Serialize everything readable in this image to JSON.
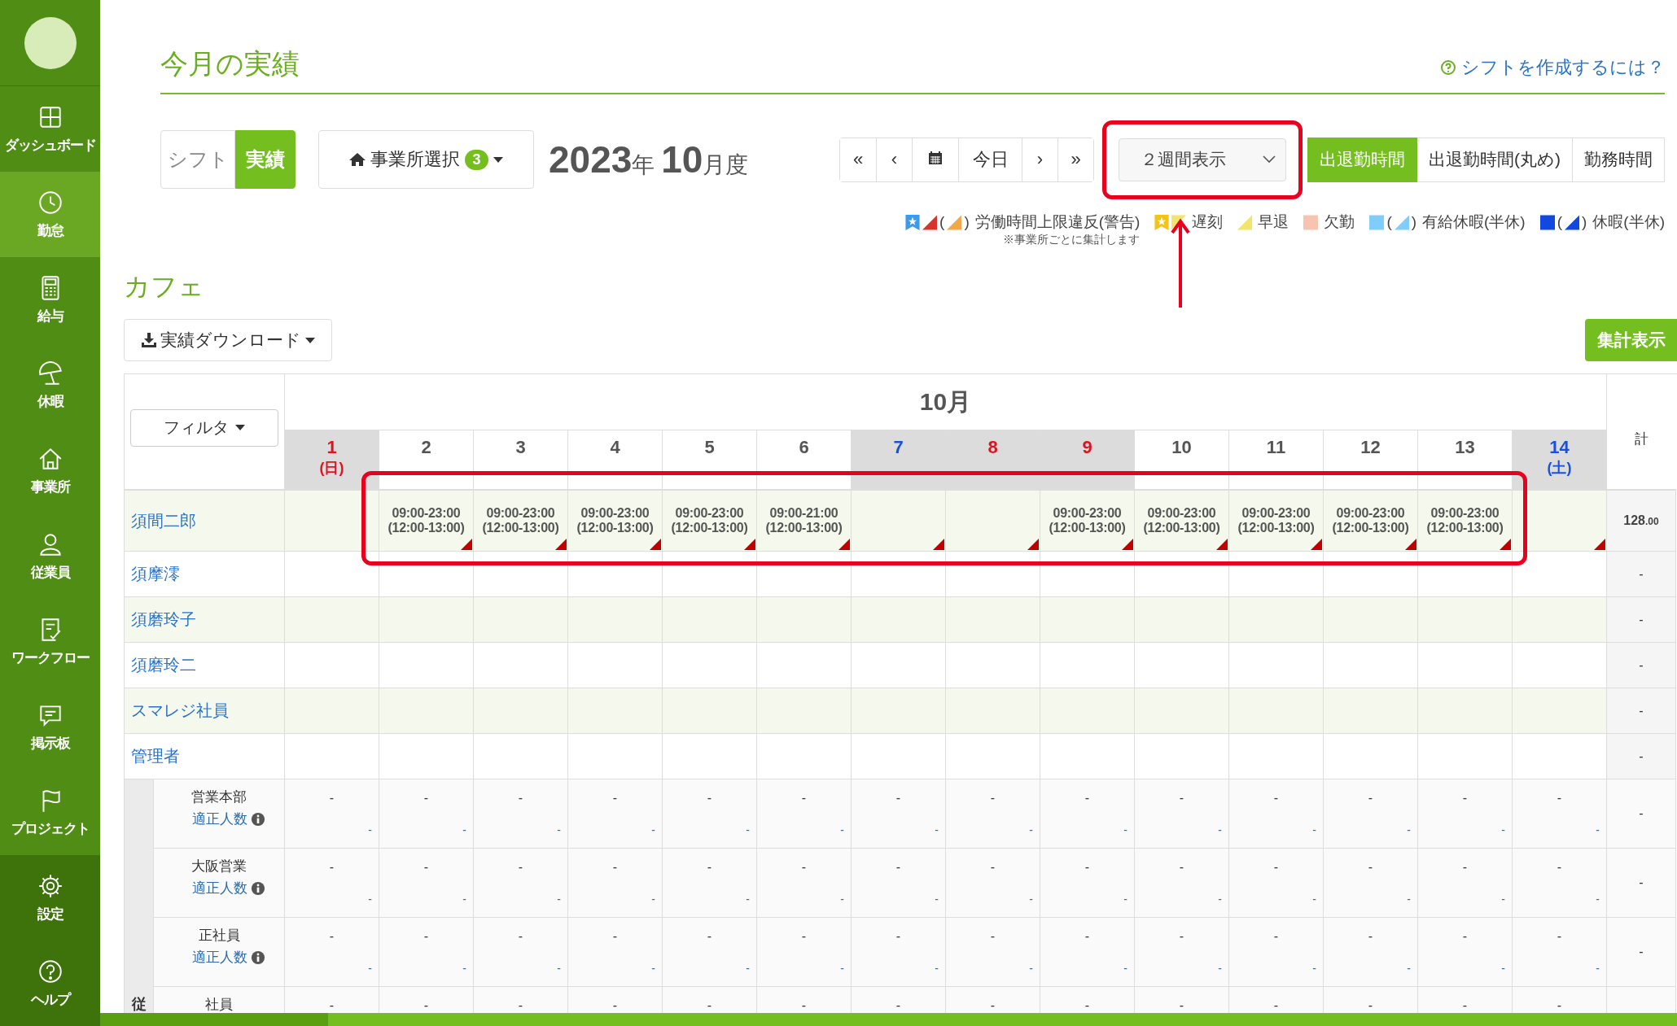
{
  "sidebar": {
    "items": [
      {
        "label": "ダッシュボード",
        "selected": false
      },
      {
        "label": "勤怠",
        "selected": true
      },
      {
        "label": "給与",
        "selected": false
      },
      {
        "label": "休暇",
        "selected": false
      },
      {
        "label": "事業所",
        "selected": false
      },
      {
        "label": "従業員",
        "selected": false
      },
      {
        "label": "ワークフロー",
        "selected": false
      },
      {
        "label": "掲示板",
        "selected": false
      },
      {
        "label": "プロジェクト",
        "selected": false
      }
    ],
    "footer_items": [
      {
        "label": "設定",
        "selected": false
      },
      {
        "label": "ヘルプ",
        "selected": false
      }
    ]
  },
  "page": {
    "title": "今月の実績",
    "help_link": "シフトを作成するには？"
  },
  "mode_toggle": [
    {
      "label": "シフト",
      "selected": false
    },
    {
      "label": "実績",
      "selected": true
    }
  ],
  "office_select": {
    "label": "事業所選択",
    "count": "3"
  },
  "period": {
    "year": "2023",
    "year_unit": "年",
    "month": "10",
    "month_unit": "月度"
  },
  "nav_buttons": [
    {
      "kind": "text",
      "label": "«"
    },
    {
      "kind": "text",
      "label": "‹"
    },
    {
      "kind": "calendar"
    },
    {
      "kind": "text",
      "label": "今日"
    },
    {
      "kind": "text",
      "label": "›"
    },
    {
      "kind": "text",
      "label": "»"
    }
  ],
  "view_select": {
    "value": "２週間表示"
  },
  "time_modes": [
    {
      "label": "出退勤時間",
      "selected": true
    },
    {
      "label": "出退勤時間(丸め)",
      "selected": false
    },
    {
      "label": "勤務時間",
      "selected": false
    }
  ],
  "legend": [
    {
      "label": "労働時間上限違反(警告)",
      "note": "※事業所ごとに集計します",
      "marks": [
        {
          "kind": "star-flag",
          "color": "#3b9be8"
        },
        {
          "kind": "triangle",
          "color": "#d9342b"
        },
        {
          "kind": "half",
          "color": "#f0a848",
          "open": "(",
          "close": ")"
        }
      ]
    },
    {
      "label": "遅刻",
      "marks": [
        {
          "kind": "star-flag",
          "color": "#f2c318"
        },
        {
          "kind": "top-triangle",
          "color": "#f3e46b"
        }
      ]
    },
    {
      "label": "早退",
      "marks": [
        {
          "kind": "triangle",
          "color": "#f3e46b"
        }
      ]
    },
    {
      "label": "欠勤",
      "marks": [
        {
          "kind": "square",
          "color": "#f7c4b0"
        }
      ]
    },
    {
      "label": "有給休暇(半休)",
      "marks": [
        {
          "kind": "square",
          "color": "#7fcdfb"
        },
        {
          "kind": "half",
          "color": "#7fcdfb",
          "open": "(",
          "close": ")"
        }
      ]
    },
    {
      "label": "休暇(半休)",
      "marks": [
        {
          "kind": "square",
          "color": "#1048e0"
        },
        {
          "kind": "half",
          "color": "#1048e0",
          "open": "(",
          "close": ")"
        }
      ]
    }
  ],
  "section": {
    "title": "カフェ",
    "download_button": "実績ダウンロード",
    "summary_button": "集計表示"
  },
  "table": {
    "filter_button": "フィルタ",
    "month": "10月",
    "total_header": "計",
    "days": [
      {
        "date": "1",
        "weekday": "(日)",
        "kind": "sunday"
      },
      {
        "date": "2",
        "kind": "weekday"
      },
      {
        "date": "3",
        "kind": "weekday"
      },
      {
        "date": "4",
        "kind": "weekday"
      },
      {
        "date": "5",
        "kind": "weekday"
      },
      {
        "date": "6",
        "kind": "weekday"
      },
      {
        "date": "7",
        "kind": "saturday"
      },
      {
        "date": "8",
        "kind": "sunday"
      },
      {
        "date": "9",
        "kind": "holiday"
      },
      {
        "date": "10",
        "kind": "weekday"
      },
      {
        "date": "11",
        "kind": "weekday"
      },
      {
        "date": "12",
        "kind": "weekday"
      },
      {
        "date": "13",
        "kind": "weekday"
      },
      {
        "date": "14",
        "weekday": "(土)",
        "kind": "saturday"
      }
    ],
    "employees": [
      {
        "name": "須間二郎",
        "total": "128",
        "total_decimals": ".00",
        "cells": [
          {
            "warning": false
          },
          {
            "time": "09:00-23:00",
            "break": "(12:00-13:00)",
            "warning": true
          },
          {
            "time": "09:00-23:00",
            "break": "(12:00-13:00)",
            "warning": true
          },
          {
            "time": "09:00-23:00",
            "break": "(12:00-13:00)",
            "warning": true
          },
          {
            "time": "09:00-23:00",
            "break": "(12:00-13:00)",
            "warning": true
          },
          {
            "time": "09:00-21:00",
            "break": "(12:00-13:00)",
            "warning": true
          },
          {
            "warning": true
          },
          {
            "warning": true
          },
          {
            "time": "09:00-23:00",
            "break": "(12:00-13:00)",
            "warning": true
          },
          {
            "time": "09:00-23:00",
            "break": "(12:00-13:00)",
            "warning": true
          },
          {
            "time": "09:00-23:00",
            "break": "(12:00-13:00)",
            "warning": true
          },
          {
            "time": "09:00-23:00",
            "break": "(12:00-13:00)",
            "warning": true
          },
          {
            "time": "09:00-23:00",
            "break": "(12:00-13:00)",
            "warning": true
          },
          {
            "warning": true
          }
        ]
      },
      {
        "name": "須摩澪",
        "total": "-",
        "cells": [
          {
            "warning": false
          },
          {
            "warning": false
          },
          {
            "warning": false
          },
          {
            "warning": false
          },
          {
            "warning": false
          },
          {
            "warning": false
          },
          {
            "warning": false
          },
          {
            "warning": false
          },
          {
            "warning": false
          },
          {
            "warning": false
          },
          {
            "warning": false
          },
          {
            "warning": false
          },
          {
            "warning": false
          },
          {
            "warning": false
          }
        ]
      },
      {
        "name": "須磨玲子",
        "total": "-",
        "cells": [
          {
            "warning": false
          },
          {
            "warning": false
          },
          {
            "warning": false
          },
          {
            "warning": false
          },
          {
            "warning": false
          },
          {
            "warning": false
          },
          {
            "warning": false
          },
          {
            "warning": false
          },
          {
            "warning": false
          },
          {
            "warning": false
          },
          {
            "warning": false
          },
          {
            "warning": false
          },
          {
            "warning": false
          },
          {
            "warning": false
          }
        ]
      },
      {
        "name": "須磨玲二",
        "total": "-",
        "cells": [
          {
            "warning": false
          },
          {
            "warning": false
          },
          {
            "warning": false
          },
          {
            "warning": false
          },
          {
            "warning": false
          },
          {
            "warning": false
          },
          {
            "warning": false
          },
          {
            "warning": false
          },
          {
            "warning": false
          },
          {
            "warning": false
          },
          {
            "warning": false
          },
          {
            "warning": false
          },
          {
            "warning": false
          },
          {
            "warning": false
          }
        ]
      },
      {
        "name": "スマレジ社員",
        "total": "-",
        "cells": [
          {
            "warning": false
          },
          {
            "warning": false
          },
          {
            "warning": false
          },
          {
            "warning": false
          },
          {
            "warning": false
          },
          {
            "warning": false
          },
          {
            "warning": false
          },
          {
            "warning": false
          },
          {
            "warning": false
          },
          {
            "warning": false
          },
          {
            "warning": false
          },
          {
            "warning": false
          },
          {
            "warning": false
          },
          {
            "warning": false
          }
        ]
      },
      {
        "name": "管理者",
        "total": "-",
        "cells": [
          {
            "warning": false
          },
          {
            "warning": false
          },
          {
            "warning": false
          },
          {
            "warning": false
          },
          {
            "warning": false
          },
          {
            "warning": false
          },
          {
            "warning": false
          },
          {
            "warning": false
          },
          {
            "warning": false
          },
          {
            "warning": false
          },
          {
            "warning": false
          },
          {
            "warning": false
          },
          {
            "warning": false
          },
          {
            "warning": false
          }
        ]
      }
    ],
    "groups_label": "従",
    "groups": [
      {
        "name": "営業本部",
        "link": "適正人数",
        "total": "-",
        "cells": [
          {
            "count": "-",
            "proper": "-"
          },
          {
            "count": "-",
            "proper": "-"
          },
          {
            "count": "-",
            "proper": "-"
          },
          {
            "count": "-",
            "proper": "-"
          },
          {
            "count": "-",
            "proper": "-"
          },
          {
            "count": "-",
            "proper": "-"
          },
          {
            "count": "-",
            "proper": "-"
          },
          {
            "count": "-",
            "proper": "-"
          },
          {
            "count": "-",
            "proper": "-"
          },
          {
            "count": "-",
            "proper": "-"
          },
          {
            "count": "-",
            "proper": "-"
          },
          {
            "count": "-",
            "proper": "-"
          },
          {
            "count": "-",
            "proper": "-"
          },
          {
            "count": "-",
            "proper": "-"
          }
        ]
      },
      {
        "name": "大阪営業",
        "link": "適正人数",
        "total": "-",
        "cells": [
          {
            "count": "-",
            "proper": "-"
          },
          {
            "count": "-",
            "proper": "-"
          },
          {
            "count": "-",
            "proper": "-"
          },
          {
            "count": "-",
            "proper": "-"
          },
          {
            "count": "-",
            "proper": "-"
          },
          {
            "count": "-",
            "proper": "-"
          },
          {
            "count": "-",
            "proper": "-"
          },
          {
            "count": "-",
            "proper": "-"
          },
          {
            "count": "-",
            "proper": "-"
          },
          {
            "count": "-",
            "proper": "-"
          },
          {
            "count": "-",
            "proper": "-"
          },
          {
            "count": "-",
            "proper": "-"
          },
          {
            "count": "-",
            "proper": "-"
          },
          {
            "count": "-",
            "proper": "-"
          }
        ]
      },
      {
        "name": "正社員",
        "link": "適正人数",
        "total": "-",
        "cells": [
          {
            "count": "-",
            "proper": "-"
          },
          {
            "count": "-",
            "proper": "-"
          },
          {
            "count": "-",
            "proper": "-"
          },
          {
            "count": "-",
            "proper": "-"
          },
          {
            "count": "-",
            "proper": "-"
          },
          {
            "count": "-",
            "proper": "-"
          },
          {
            "count": "-",
            "proper": "-"
          },
          {
            "count": "-",
            "proper": "-"
          },
          {
            "count": "-",
            "proper": "-"
          },
          {
            "count": "-",
            "proper": "-"
          },
          {
            "count": "-",
            "proper": "-"
          },
          {
            "count": "-",
            "proper": "-"
          },
          {
            "count": "-",
            "proper": "-"
          },
          {
            "count": "-",
            "proper": "-"
          }
        ]
      },
      {
        "name": "社員",
        "cells": [
          {
            "count": "-"
          },
          {
            "count": "-"
          },
          {
            "count": "-"
          },
          {
            "count": "-"
          },
          {
            "count": "-"
          },
          {
            "count": "-"
          },
          {
            "count": "-"
          },
          {
            "count": "-"
          },
          {
            "count": "-"
          },
          {
            "count": "-"
          },
          {
            "count": "-"
          },
          {
            "count": "-"
          },
          {
            "count": "-"
          },
          {
            "count": "-"
          }
        ]
      }
    ]
  }
}
